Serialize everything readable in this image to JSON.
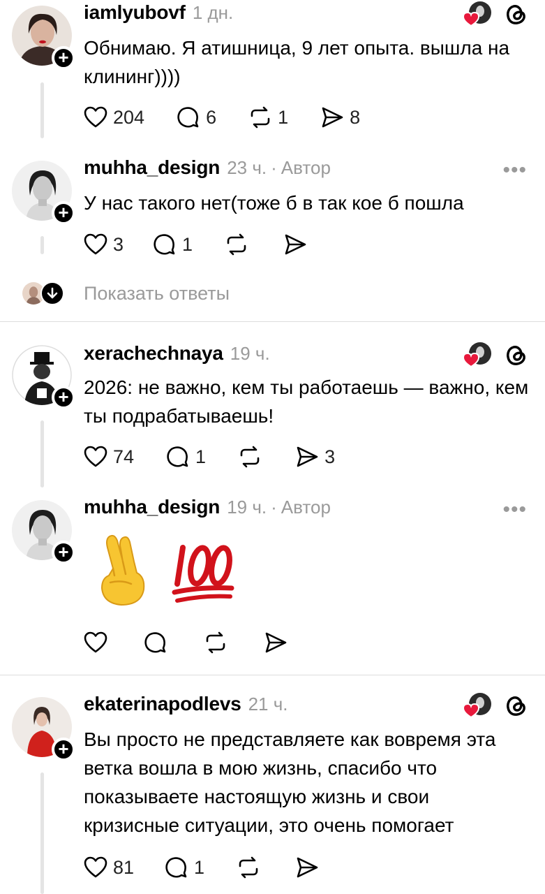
{
  "posts": [
    {
      "username": "iamlyubovf",
      "time": "1 дн.",
      "text": "Обнимаю. Я атишница, 9 лет опыта. вышла на клининг))))",
      "likes": "204",
      "replies": "6",
      "reposts": "1",
      "shares": "8"
    },
    {
      "username": "muhha_design",
      "time": "23 ч.",
      "sep": "·",
      "author": "Автор",
      "more": "•••",
      "text": "У нас такого нет(тоже б в так кое б пошла",
      "likes": "3",
      "replies": "1"
    },
    {
      "username": "xerachechnaya",
      "time": "19 ч.",
      "text": "2026: не важно, кем ты работаешь — важно, кем ты подрабатываешь!",
      "likes": "74",
      "replies": "1",
      "shares": "3"
    },
    {
      "username": "muhha_design",
      "time": "19 ч.",
      "sep": "·",
      "author": "Автор",
      "more": "•••",
      "emojis": [
        "crossed-fingers",
        "hundred-points"
      ]
    },
    {
      "username": "ekaterinapodlevs",
      "time": "21 ч.",
      "text": "Вы просто не представляете как вовремя эта ветка вошла в мою жизнь, спасибо что показываете настоящую жизнь и свои кризисные ситуации, это очень помогает",
      "likes": "81",
      "replies": "1"
    }
  ],
  "show_replies": {
    "label": "Показать ответы"
  },
  "icons": {
    "like": "heart-icon",
    "reply": "comment-icon",
    "repost": "repost-icon",
    "share": "send-icon",
    "threads": "threads-icon",
    "more": "more-icon"
  },
  "colors": {
    "meta_gray": "#9a9a9a",
    "heart_red": "#e8193c",
    "divider": "#dcdcdc",
    "emoji_yellow": "#f7c531",
    "hundred_red": "#d1121b"
  }
}
